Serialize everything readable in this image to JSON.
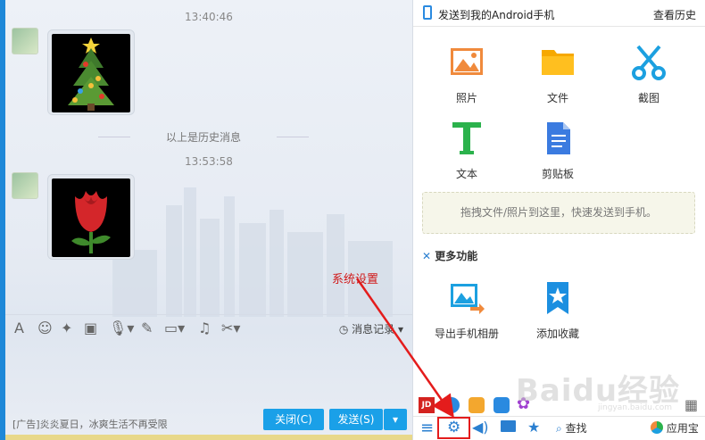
{
  "chat": {
    "timestamp_1": "13:40:46",
    "history_label": "以上是历史消息",
    "timestamp_2": "13:53:58",
    "toolbar": {
      "message_record": "消息记录"
    },
    "ad_text": "[广告]炎炎夏日，冰爽生活不再受限",
    "close_button": "关闭(C)",
    "send_button": "发送(S)"
  },
  "panel": {
    "title": "发送到我的Android手机",
    "history_link": "查看历史",
    "tiles": [
      {
        "label": "照片",
        "icon": "photo-icon",
        "color": "#f08a3c"
      },
      {
        "label": "文件",
        "icon": "folder-icon",
        "color": "#f6a800"
      },
      {
        "label": "截图",
        "icon": "scissors-icon",
        "color": "#1ca0e0"
      },
      {
        "label": "文本",
        "icon": "text-icon",
        "color": "#2bb24c"
      },
      {
        "label": "剪贴板",
        "icon": "clipboard-icon",
        "color": "#3b7be0"
      }
    ],
    "dropzone": "拖拽文件/照片到这里，快速发送到手机。",
    "more_features": "更多功能",
    "more_tiles": [
      {
        "label": "导出手机相册",
        "icon": "album-export-icon"
      },
      {
        "label": "添加收藏",
        "icon": "favorite-icon"
      }
    ],
    "bottom": {
      "search": "查找",
      "app_store": "应用宝"
    }
  },
  "annotation": {
    "callout": "系统设置"
  },
  "watermark": {
    "brand": "Baidu经验",
    "url": "jingyan.baidu.com"
  }
}
